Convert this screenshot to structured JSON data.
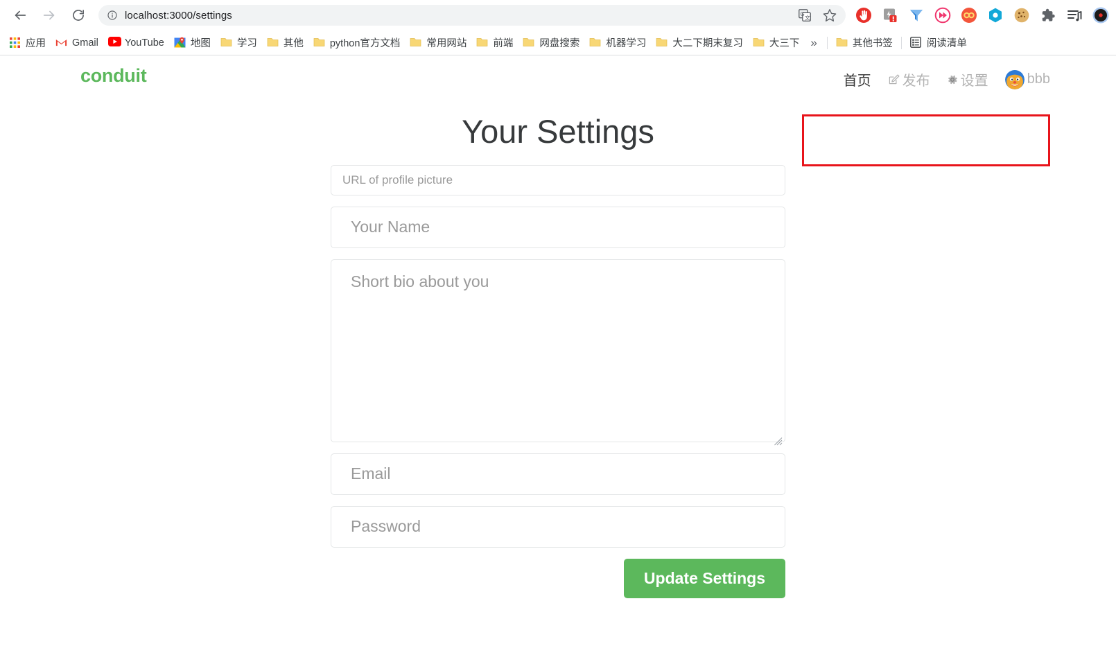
{
  "browser": {
    "back_label": "Back",
    "forward_label": "Forward",
    "reload_label": "Reload",
    "url": "localhost:3000/settings",
    "url_host": "localhost",
    "url_path": ":3000/settings",
    "site_info_icon": "info-circle-icon",
    "omnibox_icons": [
      {
        "name": "translate-icon",
        "label": "Translate this page"
      },
      {
        "name": "bookmark-star-icon",
        "label": "Bookmark this tab"
      }
    ],
    "extensions": [
      {
        "name": "adblock-stop-icon",
        "label": "AdBlock",
        "color": "#e8302a"
      },
      {
        "name": "tampermonkey-icon",
        "label": "Tampermonkey",
        "color": "#8c8c8c",
        "badge": "!"
      },
      {
        "name": "funnel-icon",
        "label": "uBlacklist",
        "color": "#2b7fd4"
      },
      {
        "name": "fast-forward-icon",
        "label": "Video Speed Controller",
        "color": "#f0356d"
      },
      {
        "name": "infinity-icon",
        "label": "Infinity New Tab",
        "color": "#f3553b"
      },
      {
        "name": "hexagon-icon",
        "label": "Octotree",
        "color": "#12a8d8"
      },
      {
        "name": "cookie-icon",
        "label": "EditThisCookie",
        "color": "#d7a85a"
      },
      {
        "name": "puzzle-icon",
        "label": "Extensions",
        "color": "#5f6368"
      },
      {
        "name": "playlist-icon",
        "label": "Media playlist",
        "color": "#3c4043"
      },
      {
        "name": "profile-avatar-icon",
        "label": "Profile",
        "color": "#1b1b1b"
      }
    ],
    "bookmarks": [
      {
        "label": "应用",
        "icon": "apps-grid-icon"
      },
      {
        "label": "Gmail",
        "icon": "gmail-icon"
      },
      {
        "label": "YouTube",
        "icon": "youtube-icon"
      },
      {
        "label": "地图",
        "icon": "google-maps-icon"
      },
      {
        "label": "学习",
        "icon": "folder-icon"
      },
      {
        "label": "其他",
        "icon": "folder-icon"
      },
      {
        "label": "python官方文档",
        "icon": "folder-icon"
      },
      {
        "label": "常用网站",
        "icon": "folder-icon"
      },
      {
        "label": "前端",
        "icon": "folder-icon"
      },
      {
        "label": "网盘搜索",
        "icon": "folder-icon"
      },
      {
        "label": "机器学习",
        "icon": "folder-icon"
      },
      {
        "label": "大二下期末复习",
        "icon": "folder-icon"
      },
      {
        "label": "大三下",
        "icon": "folder-icon"
      }
    ],
    "bookmarks_overflow": "»",
    "other_bookmarks": {
      "label": "其他书签",
      "icon": "folder-icon"
    },
    "reading_list": {
      "label": "阅读清单",
      "icon": "reading-list-icon"
    }
  },
  "site": {
    "brand": "conduit",
    "brand_color": "#5CB85C",
    "nav": [
      {
        "label": "首页",
        "icon": null,
        "active": true,
        "name": "nav-home"
      },
      {
        "label": "发布",
        "icon": "compose-icon",
        "active": false,
        "name": "nav-new-post"
      },
      {
        "label": "设置",
        "icon": "gear-icon",
        "active": false,
        "name": "nav-settings"
      },
      {
        "label": "bbb",
        "icon": "avatar",
        "active": false,
        "name": "nav-profile"
      }
    ],
    "highlight_color": "#e8141b"
  },
  "settings": {
    "title": "Your Settings",
    "fields": [
      {
        "name": "profile-picture-url-input",
        "placeholder": "URL of profile picture",
        "value": "",
        "size": "small",
        "type": "text"
      },
      {
        "name": "username-input",
        "placeholder": "Your Name",
        "value": "",
        "size": "big",
        "type": "text"
      },
      {
        "name": "bio-textarea",
        "placeholder": "Short bio about you",
        "value": "",
        "size": "bio",
        "type": "textarea"
      },
      {
        "name": "email-input",
        "placeholder": "Email",
        "value": "",
        "size": "big",
        "type": "text"
      },
      {
        "name": "password-input",
        "placeholder": "Password",
        "value": "",
        "size": "big",
        "type": "password"
      }
    ],
    "submit_label": "Update Settings",
    "submit_color": "#5CB85C"
  }
}
